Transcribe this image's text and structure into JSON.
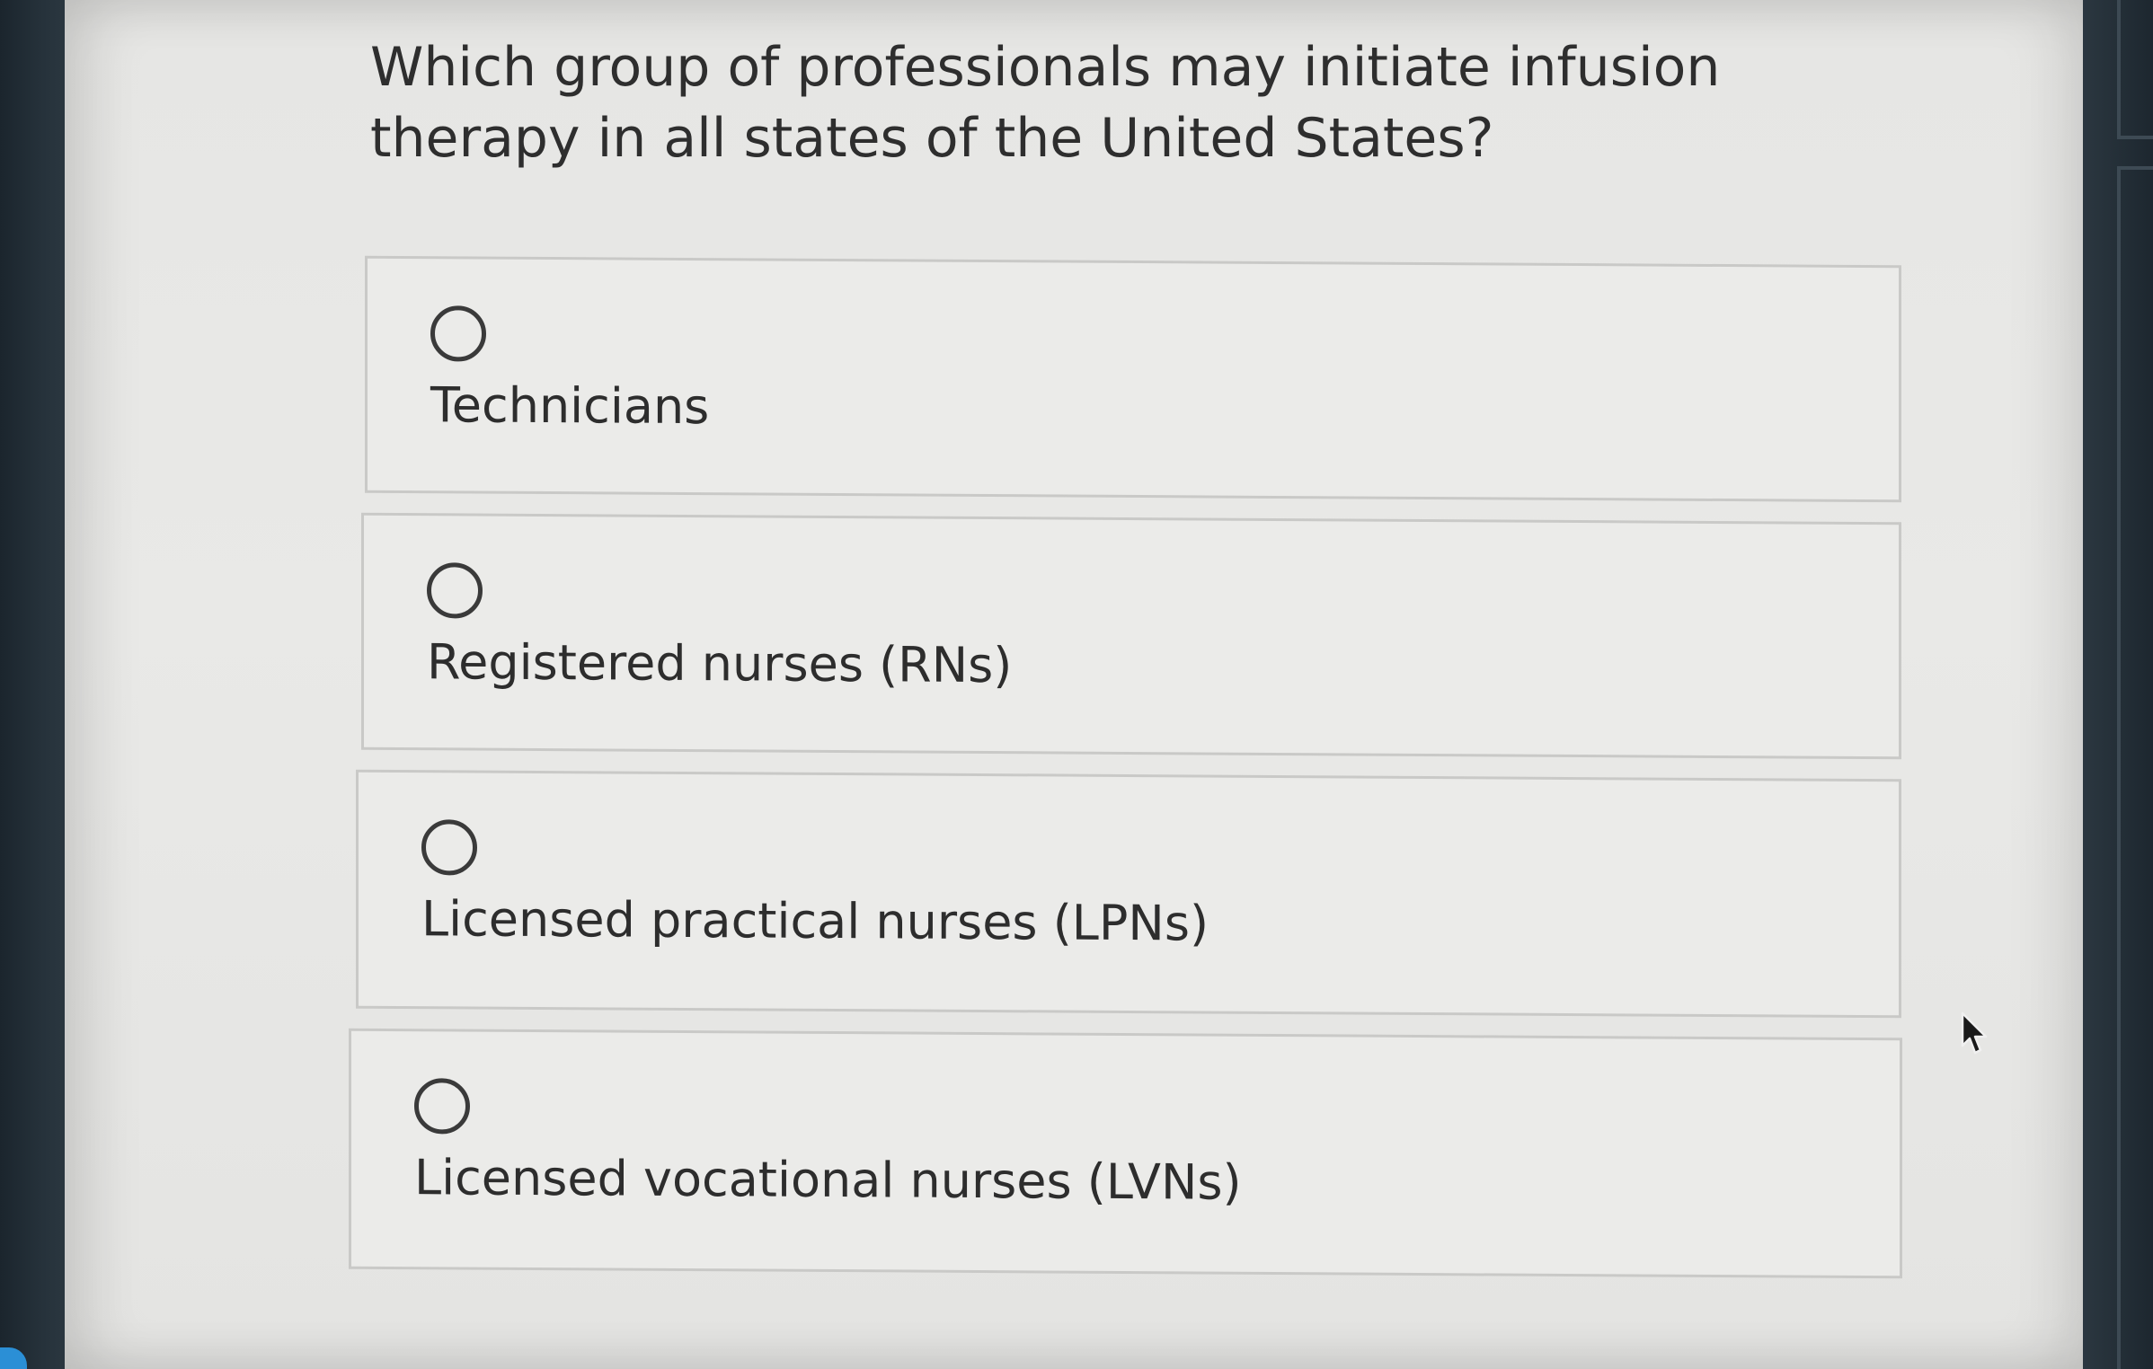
{
  "question": {
    "text": "Which group of professionals may initiate infusion therapy in all states of the United States?"
  },
  "options": [
    {
      "label": "Technicians",
      "selected": false
    },
    {
      "label": "Registered nurses (RNs)",
      "selected": false
    },
    {
      "label": "Licensed practical nurses (LPNs)",
      "selected": false
    },
    {
      "label": "Licensed vocational nurses (LVNs)",
      "selected": false
    }
  ],
  "icons": {
    "radio": "radio-unchecked-icon",
    "cursor": "mouse-pointer-icon"
  },
  "colors": {
    "page_background": "#e8e8e6",
    "text": "#2e2e2e",
    "option_border": "#c9c9c7"
  }
}
